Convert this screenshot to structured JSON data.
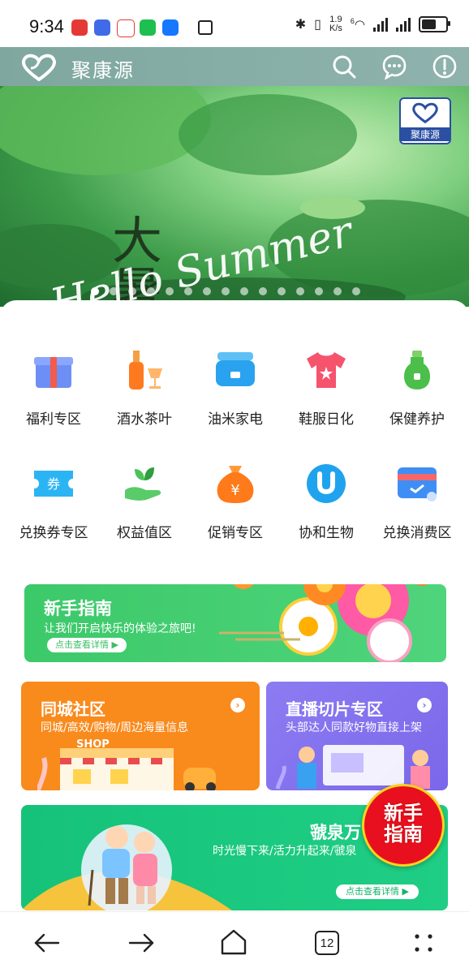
{
  "status_bar": {
    "time": "9:34",
    "net_speed_value": "1.9",
    "net_speed_unit": "K/s",
    "wifi_label": "6",
    "battery_level": 0.7
  },
  "header": {
    "brand": "聚康源",
    "icons": [
      "search-icon",
      "message-icon",
      "info-icon"
    ]
  },
  "banner": {
    "title_script": "Hello Summer",
    "title_cn": "大暑",
    "badge": "聚康源",
    "dot_count": 15,
    "active_dot": 0
  },
  "categories": [
    {
      "label": "福利专区",
      "icon": "gift-icon"
    },
    {
      "label": "酒水茶叶",
      "icon": "wine-icon"
    },
    {
      "label": "油米家电",
      "icon": "rice-cooker-icon"
    },
    {
      "label": "鞋服日化",
      "icon": "tshirt-icon"
    },
    {
      "label": "保健养护",
      "icon": "health-bottle-icon"
    },
    {
      "label": "兑换券专区",
      "icon": "coupon-icon"
    },
    {
      "label": "权益值区",
      "icon": "sprout-hand-icon"
    },
    {
      "label": "促销专区",
      "icon": "money-bag-icon"
    },
    {
      "label": "协和生物",
      "icon": "u-logo-icon"
    },
    {
      "label": "兑换消费区",
      "icon": "card-icon"
    }
  ],
  "guide_banner": {
    "title": "新手指南",
    "subtitle": "让我们开启快乐的体验之旅吧!",
    "button": "点击查看详情 ▶"
  },
  "card_city": {
    "title": "同城社区",
    "subtitle": "同城/高效/购物/周边海量信息",
    "shop_sign": "SHOP",
    "color": "#f98a1c"
  },
  "card_live": {
    "title": "直播切片专区",
    "subtitle": "头部达人同款好物直接上架",
    "color": "#8a78ef"
  },
  "card_spring": {
    "title": "虢泉万",
    "subtitle": "时光慢下来/活力升起来/虢泉",
    "button": "点击查看详情 ▶"
  },
  "float_badge": {
    "line1": "新手",
    "line2": "指南"
  },
  "nav": {
    "tab_count": "12"
  }
}
